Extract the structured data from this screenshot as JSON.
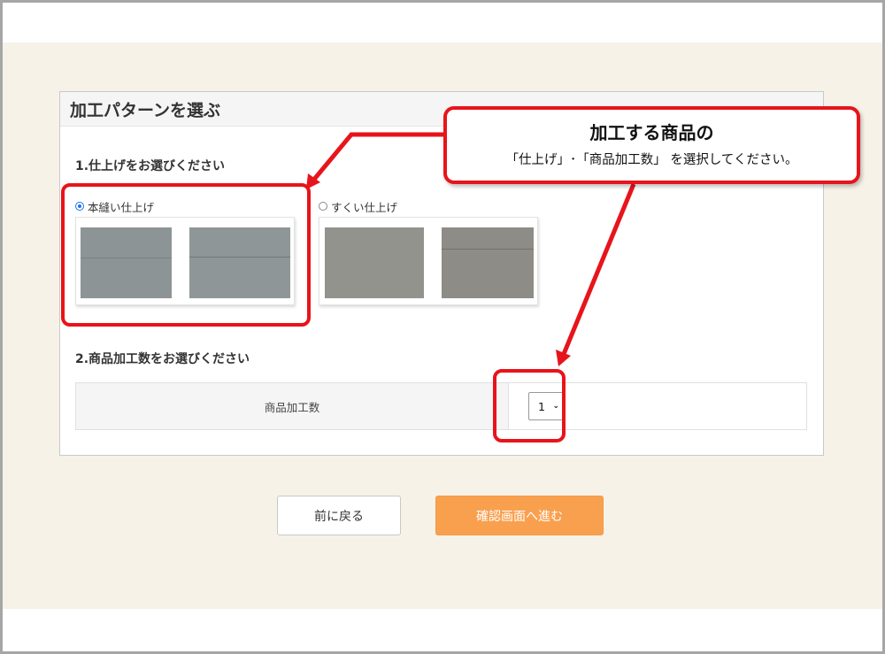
{
  "panel": {
    "title": "加工パターンを選ぶ"
  },
  "finish_section": {
    "label": "1.仕上げをお選びください",
    "options": [
      {
        "label": "本縫い仕上げ",
        "selected": true
      },
      {
        "label": "すくい仕上げ",
        "selected": false
      }
    ]
  },
  "quantity_section": {
    "label": "2.商品加工数をお選びください",
    "field_label": "商品加工数",
    "selected_value": "1"
  },
  "buttons": {
    "back_label": "前に戻る",
    "next_label": "確認画面へ進む"
  },
  "callout": {
    "title": "加工する商品の",
    "body": "「仕上げ」･「商品加工数」 を選択してください。"
  },
  "colors": {
    "highlight": "#e8141b",
    "accent_button": "#f9a04e",
    "page_background": "#f6f2e8",
    "radio_selected": "#1a73e8"
  }
}
